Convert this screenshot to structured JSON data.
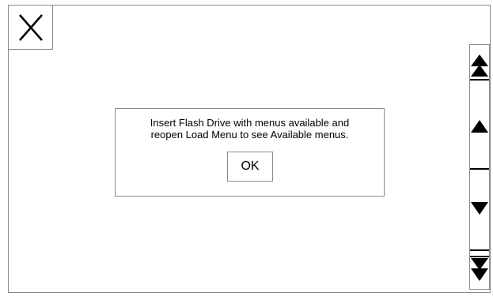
{
  "window": {
    "close_icon": "close-x-icon"
  },
  "dialog": {
    "message": "Insert Flash Drive with menus available and\nreopen Load Menu to see Available menus.",
    "ok_label": "OK"
  },
  "scrollbar": {
    "top_icon": "double-arrow-up-icon",
    "up_icon": "arrow-up-icon",
    "down_icon": "arrow-down-icon",
    "bottom_icon": "double-arrow-down-icon"
  }
}
